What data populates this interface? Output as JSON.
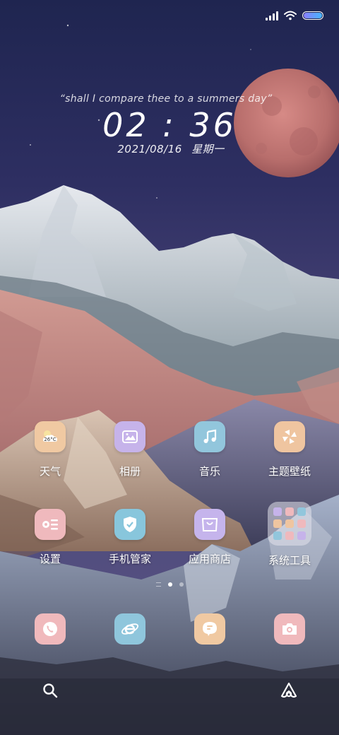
{
  "status_bar": {
    "battery_level": 1.0
  },
  "clock_widget": {
    "quote": "“shall I compare thee to a summers day”",
    "time_hours": "02",
    "time_separator": ":",
    "time_minutes": "36",
    "date": "2021/08/16",
    "weekday": "星期一"
  },
  "apps": [
    {
      "label": "天气",
      "icon": "weather-icon",
      "badge": "26°C"
    },
    {
      "label": "相册",
      "icon": "gallery-icon"
    },
    {
      "label": "音乐",
      "icon": "music-icon"
    },
    {
      "label": "主题壁纸",
      "icon": "themes-icon"
    },
    {
      "label": "设置",
      "icon": "settings-icon"
    },
    {
      "label": "手机管家",
      "icon": "security-icon"
    },
    {
      "label": "应用商店",
      "icon": "app-store-icon"
    },
    {
      "label": "系统工具",
      "icon": "folder-icon"
    }
  ],
  "dock": [
    {
      "icon": "phone-icon"
    },
    {
      "icon": "browser-icon"
    },
    {
      "icon": "messages-icon"
    },
    {
      "icon": "camera-icon"
    }
  ],
  "page_indicator": {
    "pages": 2,
    "active": 0
  },
  "colors": {
    "weather": "#f0c9a2",
    "gallery": "#c6b3ea",
    "music": "#92c6dc",
    "themes": "#efc5a0",
    "settings": "#efb9bd",
    "security": "#88c6dc",
    "app_store": "#c5b4ec",
    "phone": "#f0b9bc",
    "browser": "#8fc6dc",
    "messages": "#f0c9a2",
    "camera": "#f0b9bc"
  }
}
